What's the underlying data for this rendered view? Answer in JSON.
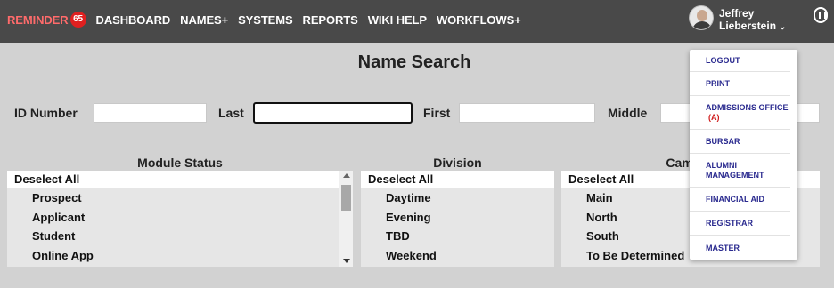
{
  "nav": {
    "reminder_label": "REMINDER",
    "reminder_count": "65",
    "items": [
      "DASHBOARD",
      "NAMES+",
      "SYSTEMS",
      "REPORTS",
      "WIKI HELP",
      "WORKFLOWS+"
    ]
  },
  "user": {
    "first": "Jeffrey",
    "last": "Lieberstein",
    "chevron": "⌄"
  },
  "page": {
    "title": "Name Search"
  },
  "search": {
    "id_label": "ID Number",
    "id_value": "",
    "last_label": "Last",
    "last_value": "",
    "first_label": "First",
    "first_value": "",
    "middle_label": "Middle",
    "middle_value": ""
  },
  "filters": {
    "module_status": {
      "header": "Module Status",
      "items": [
        "Deselect All",
        "Prospect",
        "Applicant",
        "Student",
        "Online App"
      ]
    },
    "division": {
      "header": "Division",
      "items": [
        "Deselect All",
        "Daytime",
        "Evening",
        "TBD",
        "Weekend"
      ]
    },
    "campus": {
      "header": "Campus",
      "items": [
        "Deselect All",
        "Main",
        "North",
        "South",
        "To Be Determined"
      ]
    }
  },
  "user_menu": {
    "items": [
      {
        "label": "LOGOUT",
        "tag": ""
      },
      {
        "label": "PRINT",
        "tag": ""
      },
      {
        "label": "ADMISSIONS OFFICE",
        "tag": "(A)"
      },
      {
        "label": "BURSAR",
        "tag": ""
      },
      {
        "label": "ALUMNI MANAGEMENT",
        "tag": ""
      },
      {
        "label": "FINANCIAL AID",
        "tag": ""
      },
      {
        "label": "REGISTRAR",
        "tag": ""
      },
      {
        "label": "MASTER",
        "tag": ""
      }
    ]
  },
  "colors": {
    "topbar": "#494949",
    "reminder": "#ff6b6b",
    "badge": "#e02020",
    "menu_text": "#2a2a8f",
    "tag": "#d01c1c"
  },
  "icons": {
    "help": "help-icon",
    "avatar": "user-avatar"
  }
}
